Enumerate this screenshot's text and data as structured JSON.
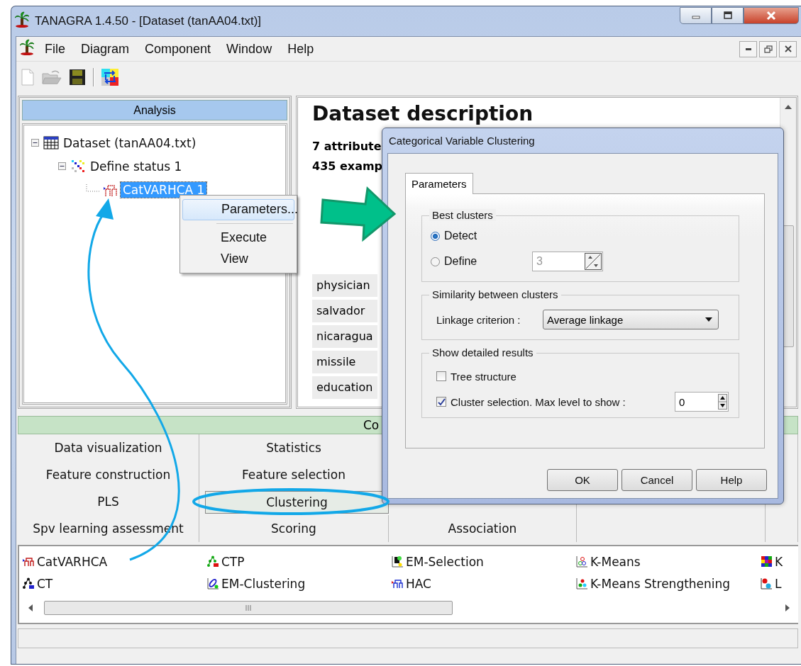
{
  "window": {
    "title": "TANAGRA 1.4.50 - [Dataset (tanAA04.txt)]"
  },
  "menu": [
    "File",
    "Diagram",
    "Component",
    "Window",
    "Help"
  ],
  "analysis": {
    "title": "Analysis",
    "tree": [
      {
        "label": "Dataset (tanAA04.txt)",
        "kind": "dataset",
        "expanded": true,
        "selected": false,
        "children": [
          {
            "label": "Define status 1",
            "kind": "status",
            "expanded": true,
            "selected": false,
            "children": [
              {
                "label": "CatVARHCA 1",
                "kind": "hca",
                "selected": true
              }
            ]
          }
        ]
      }
    ]
  },
  "report": {
    "heading": "Dataset description",
    "lines": [
      "7 attribute",
      "435 examp"
    ],
    "rows": [
      "physician",
      "salvador",
      "nicaragua",
      "missile",
      "education"
    ]
  },
  "context_menu": {
    "items": [
      {
        "kind": "command",
        "label": "Parameters...",
        "highlighted": true
      },
      {
        "kind": "separator"
      },
      {
        "kind": "command",
        "label": "Execute",
        "highlighted": false
      },
      {
        "kind": "command",
        "label": "View",
        "highlighted": false
      }
    ]
  },
  "components": {
    "header": "Co",
    "tabs": [
      [
        {
          "label": "Data visualization",
          "selected": false
        },
        {
          "label": "Statistics",
          "selected": false
        }
      ],
      [
        {
          "label": "Feature construction",
          "selected": false
        },
        {
          "label": "Feature selection",
          "selected": false
        }
      ],
      [
        {
          "label": "PLS",
          "selected": false
        },
        {
          "label": "Clustering",
          "selected": true
        }
      ],
      [
        {
          "label": "Spv learning assessment",
          "selected": false
        },
        {
          "label": "Scoring",
          "selected": false
        },
        {
          "label": "Association",
          "selected": false
        }
      ]
    ],
    "items": [
      {
        "label": "CatVARHCA",
        "kind": "hca"
      },
      {
        "label": "CT",
        "kind": "ct"
      },
      {
        "label": "CTP",
        "kind": "ctp"
      },
      {
        "label": "EM-Clustering",
        "kind": "em"
      },
      {
        "label": "EM-Selection",
        "kind": "emsel"
      },
      {
        "label": "HAC",
        "kind": "hac"
      },
      {
        "label": "K-Means",
        "kind": "kmeans"
      },
      {
        "label": "K-Means Strengthening",
        "kind": "kmeans2"
      },
      {
        "label": "K",
        "kind": "grid"
      },
      {
        "label": "L",
        "kind": "scatter"
      }
    ]
  },
  "dialog": {
    "title": "Categorical Variable Clustering",
    "tabs": [
      {
        "label": "Parameters",
        "selected": true
      }
    ],
    "best_clusters": {
      "title": "Best clusters",
      "options": [
        {
          "label": "Detect",
          "selected": true
        },
        {
          "label": "Define",
          "selected": false
        }
      ],
      "count": {
        "value": "3",
        "disabled": true
      }
    },
    "similarity": {
      "title": "Similarity between clusters",
      "label": "Linkage criterion :",
      "value": "Average linkage"
    },
    "details": {
      "title": "Show detailed results",
      "options": [
        {
          "label": "Tree structure",
          "checked": false
        },
        {
          "label": "Cluster selection. Max level to show :",
          "checked": true
        }
      ],
      "max_level": "0"
    },
    "buttons": [
      "OK",
      "Cancel",
      "Help"
    ]
  }
}
